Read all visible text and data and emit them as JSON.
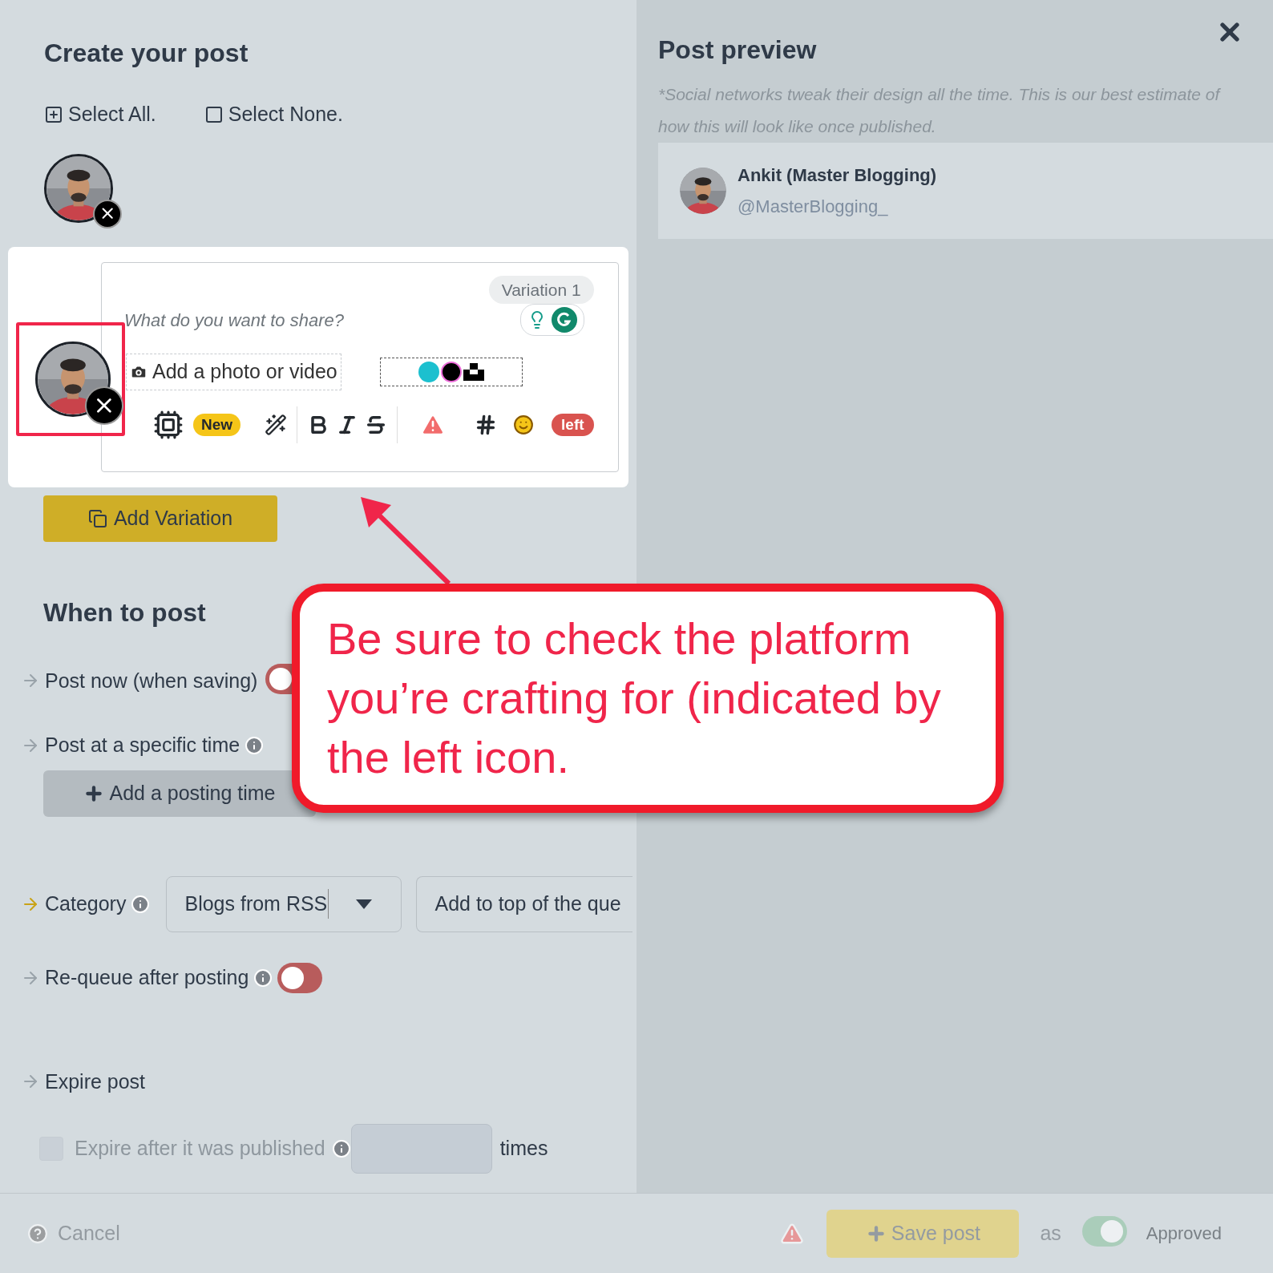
{
  "composer": {
    "title": "Create your post",
    "select": [
      {
        "label": "Select All.",
        "kind": "all"
      },
      {
        "label": "Select None.",
        "kind": "none"
      }
    ],
    "editor": {
      "variation": "Variation 1",
      "placeholder": "What do you want to share?",
      "media_button": "Add a photo or video",
      "new_badge": "New",
      "counter": "left"
    },
    "add_variation": "Add Variation"
  },
  "schedule": {
    "title": "When to post",
    "post_now": {
      "label": "Post now (when saving)",
      "on": false
    },
    "specific_time": {
      "label": "Post at a specific time",
      "button": "Add a posting time"
    },
    "category": {
      "label": "Category",
      "value": "Blogs from RSS",
      "position": "Add to top of the que"
    },
    "requeue": {
      "label": "Re-queue after posting",
      "on": false
    },
    "expire": {
      "label": "Expire post",
      "checkbox_label": "Expire after it was published",
      "checked": false,
      "unit": "times"
    }
  },
  "preview": {
    "title": "Post preview",
    "note": "*Social networks tweak their design all the time. This is our best estimate of how this will look like once published.",
    "name": "Ankit (Master Blogging)",
    "handle": "@MasterBlogging_"
  },
  "footer": {
    "cancel": "Cancel",
    "save": "Save post",
    "as": "as",
    "status": "Approved",
    "approved": true
  },
  "callout": {
    "text": "Be sure to check the platform you’re crafting for (indicated by the left icon."
  }
}
